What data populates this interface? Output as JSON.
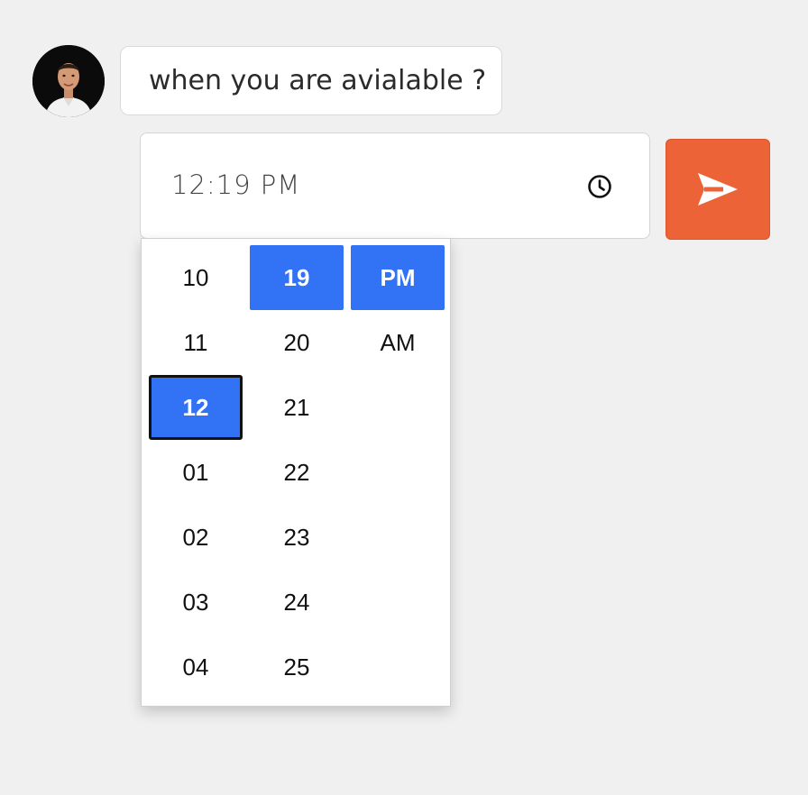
{
  "message": {
    "text": "when you are avialable ?"
  },
  "time_input": {
    "value": "12:19 PM",
    "icon": "clock-icon"
  },
  "send_button": {
    "icon": "send-icon",
    "color": "#ec6337"
  },
  "picker": {
    "hours": [
      "10",
      "11",
      "12",
      "01",
      "02",
      "03",
      "04"
    ],
    "minutes": [
      "19",
      "20",
      "21",
      "22",
      "23",
      "24",
      "25"
    ],
    "periods": [
      "PM",
      "AM"
    ],
    "selected_hour": "12",
    "selected_minute": "19",
    "selected_period": "PM",
    "accent_color": "#3273f5"
  }
}
